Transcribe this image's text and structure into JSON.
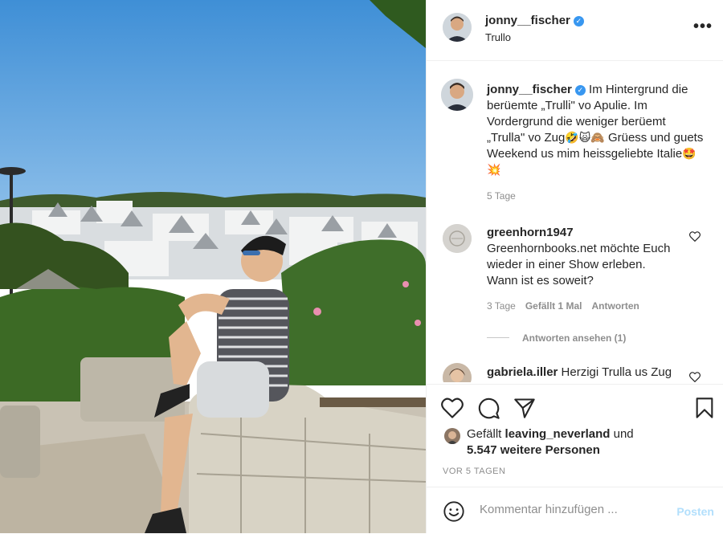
{
  "post": {
    "username": "jonny__fischer",
    "location": "Trullo",
    "verified_mark": "✓",
    "more_label": "•••",
    "caption": {
      "username": "jonny__fischer",
      "text_1": "Im Hintergrund die berüemte „Trulli\" vo Apulie. Im Vordergrund die weniger berüemt „Trulla\" vo Zug",
      "emoji_1": "🤣🙀🙈",
      "text_2": "Grüess und guets Weekend us mim heissgeliebte Italie",
      "emoji_2": "🤩💥",
      "age": "5 Tage"
    },
    "comments": [
      {
        "username": "greenhorn1947",
        "text": "Greenhornbooks.net möchte Euch wieder in einer Show erleben. Wann ist es soweit?",
        "age": "3 Tage",
        "likes": "Gefällt 1 Mal",
        "reply": "Antworten",
        "view_replies": "Antworten ansehen (1)"
      },
      {
        "username": "gabriela.iller",
        "text": "Herzigi Trulla us Zug"
      }
    ],
    "likes": {
      "prefix": "Gefällt",
      "user": "leaving_neverland",
      "joiner": "und",
      "others": "5.547 weitere Personen"
    },
    "timestamp": "VOR 5 TAGEN",
    "add_comment": {
      "placeholder": "Kommentar hinzufügen ...",
      "post_label": "Posten"
    }
  },
  "icons": {
    "like": "heart-icon",
    "comment": "comment-icon",
    "share": "paper-plane-icon",
    "save": "bookmark-icon",
    "emoji": "smiley-icon",
    "comment_like": "heart-icon"
  },
  "colors": {
    "verified": "#3897f0",
    "post_disabled": "#b2dffc",
    "meta_gray": "#8e8e8e",
    "text": "#262626"
  }
}
